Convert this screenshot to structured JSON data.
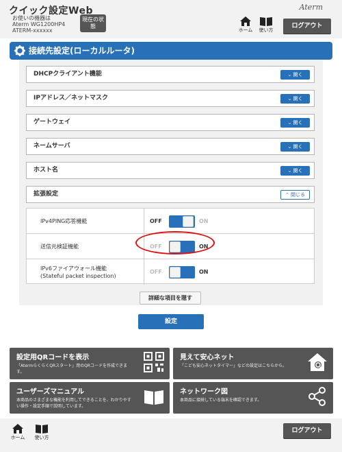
{
  "header": {
    "app_title": "クイック設定Web",
    "device_line1": "お使いの機器は",
    "device_line2": "Aterm WG1200HP4",
    "device_line3": "ATERM-xxxxxx",
    "status_button": "現在の状態",
    "home_label": "ホーム",
    "guide_label": "使い方",
    "logo": "Aterm",
    "logout_label": "ログアウト"
  },
  "section": {
    "title": "接続先設定(ローカルルータ)"
  },
  "accordions": [
    {
      "label": "DHCPクライアント機能",
      "button": "開く"
    },
    {
      "label": "IPアドレス／ネットマスク",
      "button": "開く"
    },
    {
      "label": "ゲートウェイ",
      "button": "開く"
    },
    {
      "label": "ネームサーバ",
      "button": "開く"
    },
    {
      "label": "ホスト名",
      "button": "開く"
    },
    {
      "label": "拡張設定",
      "button": "閉じる"
    }
  ],
  "settings": [
    {
      "label": "IPv4PING応答機能",
      "label2": "",
      "off": "OFF",
      "on": "ON",
      "state": "off"
    },
    {
      "label": "送信元検証機能",
      "label2": "",
      "off": "OFF",
      "on": "ON",
      "state": "on"
    },
    {
      "label": "IPv6ファイアウォール機能",
      "label2": "(Stateful packet inspection)",
      "off": "OFF",
      "on": "ON",
      "state": "on"
    }
  ],
  "buttons": {
    "hide_details": "詳細な項目を隠す",
    "submit": "設定"
  },
  "cards": [
    {
      "title": "設定用QRコードを表示",
      "desc": "「AtermらくらくQRスタート」用のQRコードを作成できます。",
      "icon": "qr-code-icon"
    },
    {
      "title": "見えて安心ネット",
      "desc": "「こども安心ネットタイマー」などの設定はこちらから。",
      "icon": "home-shield-icon"
    },
    {
      "title": "ユーザーズマニュアル",
      "desc": "本商品のさまざまな機能を利用してできることを、わかりやすい操作・設定手順で説明しています。",
      "icon": "book-icon"
    },
    {
      "title": "ネットワーク図",
      "desc": "本商品に接続している端末を確認できます。",
      "icon": "network-share-icon"
    }
  ],
  "footer": {
    "home_label": "ホーム",
    "guide_label": "使い方",
    "logout_label": "ログアウト"
  },
  "colors": {
    "accent": "#2871b8",
    "dark": "#555555",
    "highlight": "#e01010"
  }
}
